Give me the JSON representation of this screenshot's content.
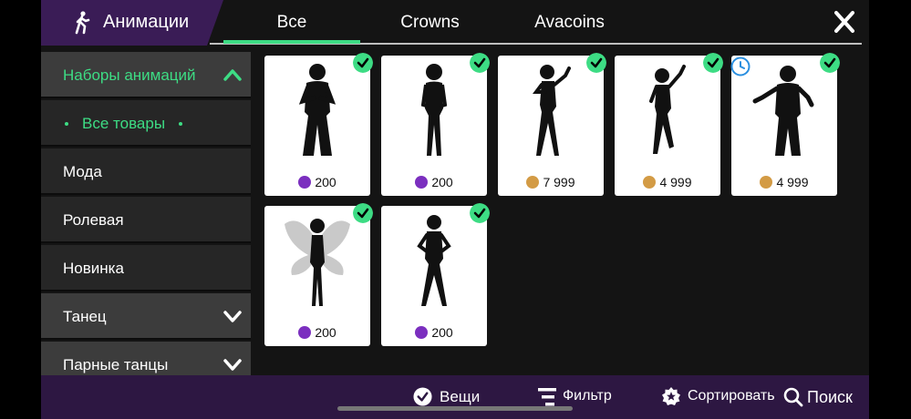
{
  "header": {
    "title": "Анимации",
    "title_icon": "walking-person-icon",
    "tabs": [
      {
        "label": "Все",
        "active": true
      },
      {
        "label": "Crowns",
        "active": false
      },
      {
        "label": "Avacoins",
        "active": false
      }
    ],
    "close_icon": "close-icon"
  },
  "colors": {
    "accent": "#3ddc84",
    "title_bg": "#3a1c56",
    "bottom_bar_bg": "#2d1742",
    "crown": "#7b2fbf",
    "coin": "#d39b45"
  },
  "sidebar": {
    "items": [
      {
        "label": "Наборы анимаций",
        "type": "section",
        "expanded": true
      },
      {
        "label": "Все товары",
        "type": "sub",
        "selected": true
      },
      {
        "label": "Мода",
        "type": "sub"
      },
      {
        "label": "Ролевая",
        "type": "sub"
      },
      {
        "label": "Новинка",
        "type": "sub"
      },
      {
        "label": "Танец",
        "type": "section",
        "expanded": false
      },
      {
        "label": "Парные танцы",
        "type": "section",
        "expanded": false
      }
    ]
  },
  "items": [
    {
      "price": "200",
      "currency": "crown",
      "badge": "check"
    },
    {
      "price": "200",
      "currency": "crown",
      "badge": "check"
    },
    {
      "price": "7 999",
      "currency": "coin",
      "badge": "check"
    },
    {
      "price": "4 999",
      "currency": "coin",
      "badge": "check"
    },
    {
      "price": "4 999",
      "currency": "coin",
      "badge": "clock"
    },
    {
      "price": "200",
      "currency": "crown",
      "badge": "check"
    },
    {
      "price": "200",
      "currency": "crown",
      "badge": "check"
    }
  ],
  "bottom_bar": {
    "items_label": "Вещи",
    "filter_label": "Фильтр",
    "sort_label": "Сортировать",
    "search_label": "Поиск"
  }
}
